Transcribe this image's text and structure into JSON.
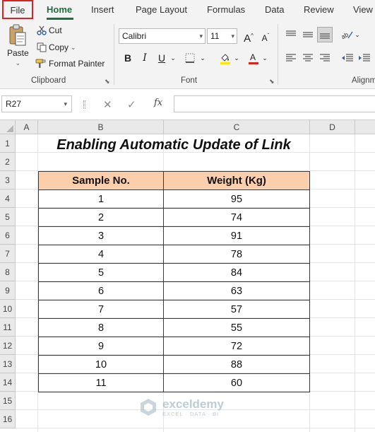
{
  "tabs": [
    {
      "label": "File",
      "active": false
    },
    {
      "label": "Home",
      "active": true
    },
    {
      "label": "Insert",
      "active": false
    },
    {
      "label": "Page Layout",
      "active": false
    },
    {
      "label": "Formulas",
      "active": false
    },
    {
      "label": "Data",
      "active": false
    },
    {
      "label": "Review",
      "active": false
    },
    {
      "label": "View",
      "active": false
    }
  ],
  "ribbon": {
    "clipboard": {
      "paste_label": "Paste",
      "cut_label": "Cut",
      "copy_label": "Copy",
      "format_painter_label": "Format Painter",
      "group_label": "Clipboard"
    },
    "font": {
      "font_name": "Calibri",
      "font_size": "11",
      "bold": "B",
      "italic": "I",
      "underline": "U",
      "group_label": "Font",
      "increase_size": "A",
      "decrease_size": "A"
    },
    "alignment": {
      "group_label": "Alignme"
    }
  },
  "formula_bar": {
    "name_box": "R27",
    "fx": "fx",
    "formula": ""
  },
  "grid": {
    "columns": [
      "A",
      "B",
      "C",
      "D"
    ],
    "rows": [
      "1",
      "2",
      "3",
      "4",
      "5",
      "6",
      "7",
      "8",
      "9",
      "10",
      "11",
      "12",
      "13",
      "14",
      "15",
      "16"
    ],
    "title": "Enabling Automatic Update of Link",
    "table": {
      "headers": [
        "Sample No.",
        "Weight (Kg)"
      ],
      "rows": [
        [
          "1",
          "95"
        ],
        [
          "2",
          "74"
        ],
        [
          "3",
          "91"
        ],
        [
          "4",
          "78"
        ],
        [
          "5",
          "84"
        ],
        [
          "6",
          "63"
        ],
        [
          "7",
          "57"
        ],
        [
          "8",
          "55"
        ],
        [
          "9",
          "72"
        ],
        [
          "10",
          "88"
        ],
        [
          "11",
          "60"
        ]
      ]
    }
  },
  "watermark": {
    "name": "exceldemy",
    "tagline": "EXCEL · DATA · BI"
  },
  "colors": {
    "accent_green": "#1e6e3e",
    "header_fill": "#fbcfac",
    "file_highlight": "#e02020"
  }
}
